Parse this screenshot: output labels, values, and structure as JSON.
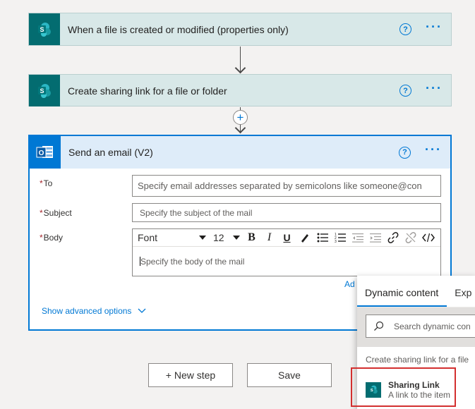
{
  "steps": {
    "trigger": {
      "title": "When a file is created or modified (properties only)",
      "icon": "sharepoint-icon"
    },
    "action1": {
      "title": "Create sharing link for a file or folder",
      "icon": "sharepoint-icon"
    },
    "email": {
      "title": "Send an email (V2)",
      "icon": "outlook-icon",
      "to_label": "To",
      "to_placeholder": "Specify email addresses separated by semicolons like someone@con",
      "subject_label": "Subject",
      "subject_placeholder": "Specify the subject of the mail",
      "body_label": "Body",
      "body_placeholder": "Specify the body of the mail",
      "font_value": "Font",
      "font_size_value": "12",
      "add_dynamic_partial": "Ad",
      "advanced_label": "Show advanced options"
    }
  },
  "help_glyph": "?",
  "more_glyph": "···",
  "buttons": {
    "new_step": "+ New step",
    "save": "Save"
  },
  "dynamic_panel": {
    "tabs": [
      "Dynamic content",
      "Exp"
    ],
    "search_placeholder": "Search dynamic con",
    "group_label": "Create sharing link for a file",
    "items": [
      {
        "name": "Sharing Link",
        "description": "A link to the item"
      }
    ]
  },
  "colors": {
    "accent": "#0078d4",
    "sharepoint": "#036c70",
    "highlight": "#d32f2f"
  }
}
